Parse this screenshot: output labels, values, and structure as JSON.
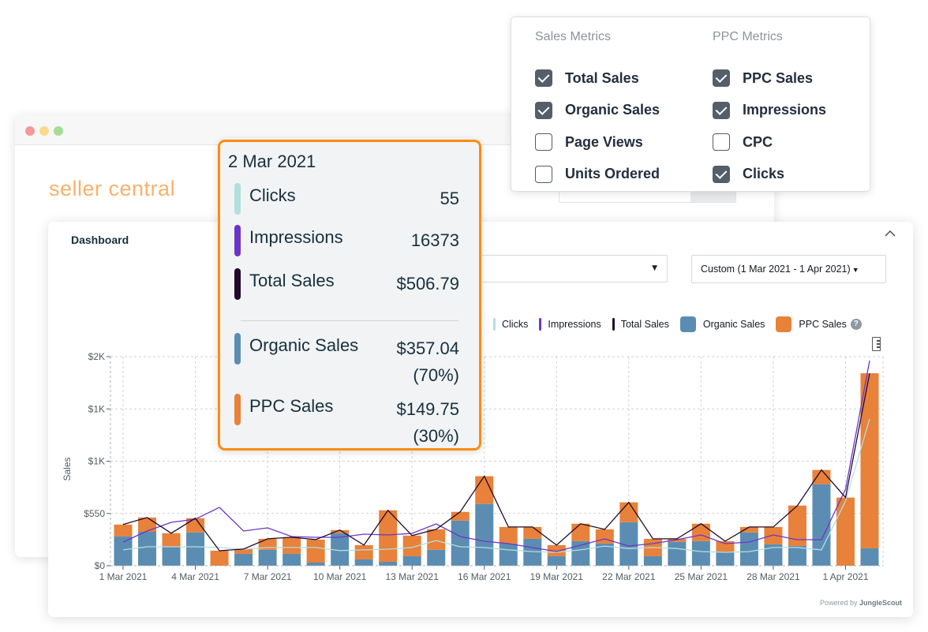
{
  "background_window": {
    "brand": "seller central"
  },
  "metrics_popover": {
    "columns": [
      {
        "heading": "Sales Metrics",
        "options": [
          {
            "label": "Total Sales",
            "checked": true
          },
          {
            "label": "Organic Sales",
            "checked": true
          },
          {
            "label": "Page Views",
            "checked": false
          },
          {
            "label": "Units Ordered",
            "checked": false
          }
        ]
      },
      {
        "heading": "PPC Metrics",
        "options": [
          {
            "label": "PPC Sales",
            "checked": true
          },
          {
            "label": "Impressions",
            "checked": true
          },
          {
            "label": "CPC",
            "checked": false
          },
          {
            "label": "Clicks",
            "checked": true
          }
        ]
      }
    ]
  },
  "dashboard": {
    "title": "Dashboard",
    "collapse_icon": "chevron-up-icon",
    "product_select_value": "",
    "date_range_value": "Custom (1 Mar 2021 - 1 Apr 2021)",
    "powered_by_prefix": "Powered by",
    "powered_by_brand": "JungleScout"
  },
  "tooltip": {
    "date": "2 Mar 2021",
    "rows": [
      {
        "label": "Clicks",
        "value": "55",
        "color": "#b2e0dc"
      },
      {
        "label": "Impressions",
        "value": "16373",
        "color": "#6c35c9"
      },
      {
        "label": "Total Sales",
        "value": "$506.79",
        "color": "#220a2a"
      },
      {
        "label": "Organic Sales",
        "value": "$357.04",
        "pct": "(70%)",
        "color": "#5b8db3"
      },
      {
        "label": "PPC Sales",
        "value": "$149.75",
        "pct": "(30%)",
        "color": "#e8813a"
      }
    ]
  },
  "chart_data": {
    "type": "bar",
    "title": "",
    "xlabel": "",
    "ylabel": "Sales",
    "stacked": true,
    "grid": true,
    "legend_position": "top-right",
    "ylim": [
      0,
      2200
    ],
    "y_ticks": [
      {
        "value": 0,
        "label": "$0"
      },
      {
        "value": 550,
        "label": "$550"
      },
      {
        "value": 1100,
        "label": "$1K"
      },
      {
        "value": 1650,
        "label": "$1K"
      },
      {
        "value": 2200,
        "label": "$2K"
      }
    ],
    "x_tick_labels": [
      "1 Mar 2021",
      "4 Mar 2021",
      "7 Mar 2021",
      "10 Mar 2021",
      "13 Mar 2021",
      "16 Mar 2021",
      "19 Mar 2021",
      "22 Mar 2021",
      "25 Mar 2021",
      "28 Mar 2021",
      "1 Apr 2021"
    ],
    "x_tick_every": 3,
    "categories": [
      "1 Mar",
      "2 Mar",
      "3 Mar",
      "4 Mar",
      "5 Mar",
      "6 Mar",
      "7 Mar",
      "8 Mar",
      "9 Mar",
      "10 Mar",
      "11 Mar",
      "12 Mar",
      "13 Mar",
      "14 Mar",
      "15 Mar",
      "16 Mar",
      "17 Mar",
      "18 Mar",
      "19 Mar",
      "20 Mar",
      "21 Mar",
      "22 Mar",
      "23 Mar",
      "24 Mar",
      "25 Mar",
      "26 Mar",
      "27 Mar",
      "28 Mar",
      "29 Mar",
      "30 Mar",
      "31 Mar",
      "1 Apr"
    ],
    "series": [
      {
        "name": "Organic Sales",
        "kind": "bar",
        "color": "#5b8db3",
        "values": [
          308,
          357,
          200,
          350,
          0,
          125,
          167,
          125,
          33,
          342,
          67,
          42,
          100,
          167,
          475,
          650,
          233,
          283,
          100,
          258,
          233,
          458,
          100,
          250,
          258,
          142,
          350,
          225,
          208,
          858,
          0,
          183
        ]
      },
      {
        "name": "PPC Sales",
        "kind": "bar",
        "color": "#e8813a",
        "values": [
          125,
          150,
          142,
          150,
          158,
          50,
          116,
          175,
          242,
          33,
          150,
          541,
          217,
          216,
          92,
          292,
          175,
          125,
          117,
          184,
          150,
          209,
          183,
          33,
          184,
          116,
          58,
          183,
          425,
          150,
          717,
          1842
        ]
      },
      {
        "name": "Total Sales",
        "kind": "line",
        "color": "#220a2a",
        "values": [
          433,
          507,
          342,
          500,
          158,
          175,
          283,
          300,
          275,
          375,
          217,
          583,
          317,
          383,
          567,
          942,
          408,
          408,
          217,
          442,
          383,
          667,
          283,
          283,
          442,
          258,
          408,
          408,
          633,
          1008,
          717,
          2025
        ]
      },
      {
        "name": "Impressions",
        "kind": "line",
        "axis": "secondary",
        "color": "#6c35c9",
        "values": [
          11160,
          16373,
          20460,
          21950,
          27530,
          16370,
          17860,
          13770,
          13390,
          13390,
          14880,
          14510,
          15250,
          19720,
          13770,
          11530,
          10420,
          8560,
          6700,
          9670,
          12650,
          9300,
          10420,
          12280,
          14510,
          10420,
          11160,
          14510,
          12280,
          12280,
          36080,
          96720
        ]
      },
      {
        "name": "Clicks",
        "kind": "line",
        "axis": "secondary",
        "color": "#b2e0dc",
        "values": [
          46,
          55,
          55,
          55,
          53,
          48,
          53,
          53,
          53,
          44,
          46,
          48,
          53,
          73,
          55,
          53,
          46,
          41,
          39,
          46,
          57,
          50,
          53,
          50,
          41,
          39,
          41,
          53,
          53,
          46,
          188,
          426
        ]
      }
    ],
    "legend": [
      {
        "name": "Clicks",
        "style": "line",
        "color": "#b2e0dc"
      },
      {
        "name": "Impressions",
        "style": "line",
        "color": "#6c35c9"
      },
      {
        "name": "Total Sales",
        "style": "line",
        "color": "#220a2a"
      },
      {
        "name": "Organic Sales",
        "style": "box",
        "color": "#5b8db3"
      },
      {
        "name": "PPC Sales",
        "style": "box",
        "color": "#e8813a"
      }
    ],
    "legend_help_icon": "question-circle-icon"
  }
}
